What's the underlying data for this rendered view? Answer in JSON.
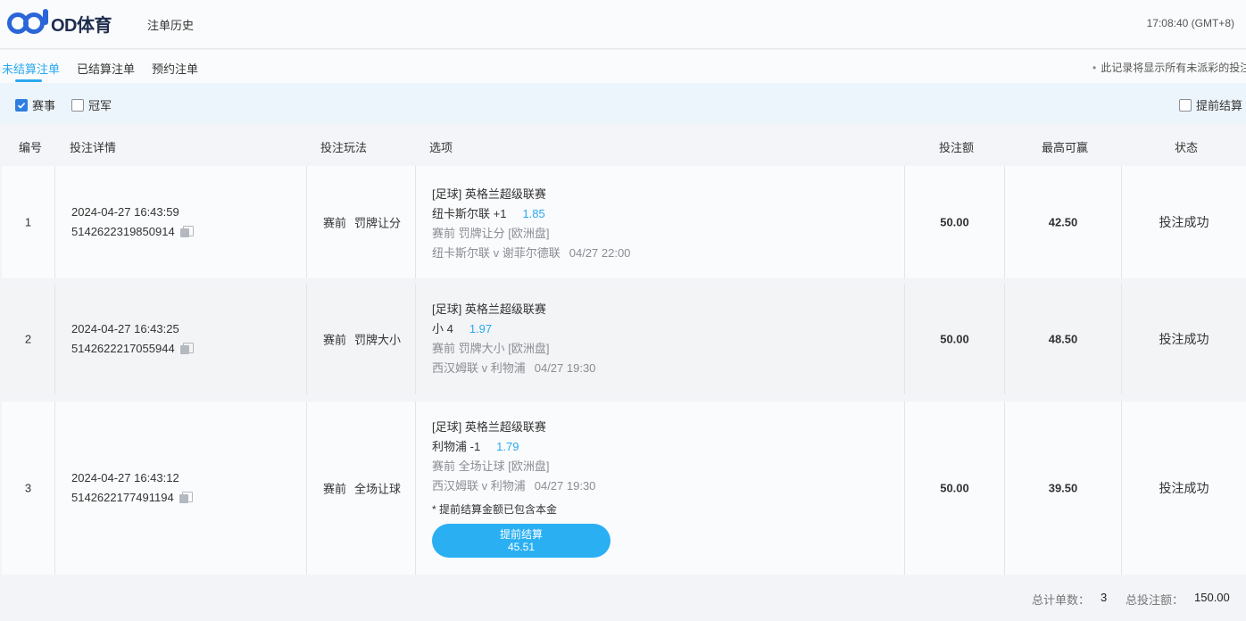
{
  "header": {
    "logo_text": "OD体育",
    "nav_history": "注单历史",
    "clock": "17:08:40 (GMT+8)"
  },
  "tabs": [
    {
      "label": "未结算注单",
      "active": true
    },
    {
      "label": "已结算注单",
      "active": false
    },
    {
      "label": "预约注单",
      "active": false
    }
  ],
  "notice": "此记录将显示所有未派彩的投注",
  "filters": {
    "event": {
      "label": "赛事",
      "checked": true
    },
    "outright": {
      "label": "冠军",
      "checked": false
    },
    "early_settle": {
      "label": "提前结算",
      "checked": false
    }
  },
  "table": {
    "headers": {
      "num": "编号",
      "detail": "投注详情",
      "play": "投注玩法",
      "option": "选项",
      "stake": "投注额",
      "max_win": "最高可赢",
      "status": "状态"
    },
    "rows": [
      {
        "num": "1",
        "time": "2024-04-27 16:43:59",
        "bet_id": "5142622319850914",
        "play_stage": "赛前",
        "play_type": "罚牌让分",
        "league": "[足球] 英格兰超级联赛",
        "pick": "纽卡斯尔联 +1",
        "odds": "1.85",
        "market": "赛前 罚牌让分 [欧洲盘]",
        "match": "纽卡斯尔联 v 谢菲尔德联",
        "match_time": "04/27 22:00",
        "stake": "50.00",
        "max_win": "42.50",
        "status": "投注成功"
      },
      {
        "num": "2",
        "time": "2024-04-27 16:43:25",
        "bet_id": "5142622217055944",
        "play_stage": "赛前",
        "play_type": "罚牌大小",
        "league": "[足球] 英格兰超级联赛",
        "pick": "小 4",
        "odds": "1.97",
        "market": "赛前 罚牌大小 [欧洲盘]",
        "match": "西汉姆联 v 利物浦",
        "match_time": "04/27 19:30",
        "stake": "50.00",
        "max_win": "48.50",
        "status": "投注成功"
      },
      {
        "num": "3",
        "time": "2024-04-27 16:43:12",
        "bet_id": "5142622177491194",
        "play_stage": "赛前",
        "play_type": "全场让球",
        "league": "[足球] 英格兰超级联赛",
        "pick": "利物浦 -1",
        "odds": "1.79",
        "market": "赛前 全场让球 [欧洲盘]",
        "match": "西汉姆联 v 利物浦",
        "match_time": "04/27 19:30",
        "note": "* 提前结算金额已包含本金",
        "cashout_label": "提前结算",
        "cashout_amount": "45.51",
        "stake": "50.00",
        "max_win": "39.50",
        "status": "投注成功"
      }
    ]
  },
  "footer": {
    "total_count_label": "总计单数：",
    "total_count": "3",
    "total_stake_label": "总投注额：",
    "total_stake": "150.00"
  }
}
